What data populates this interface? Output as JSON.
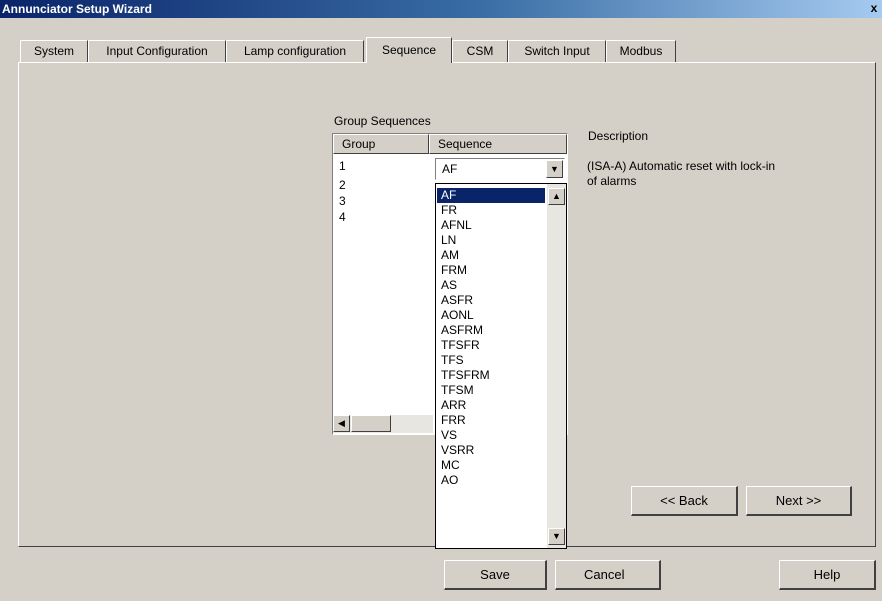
{
  "window": {
    "title": "Annunciator Setup Wizard",
    "close": "x"
  },
  "tabs": [
    "System",
    "Input Configuration",
    "Lamp configuration",
    "Sequence",
    "CSM",
    "Switch Input",
    "Modbus"
  ],
  "group_sequences": {
    "label": "Group Sequences",
    "columns": [
      "Group",
      "Sequence"
    ],
    "groups": [
      "1",
      "2",
      "3",
      "4"
    ],
    "selected_sequence": "AF"
  },
  "dropdown": {
    "options": [
      "AF",
      "FR",
      "AFNL",
      "LN",
      "AM",
      "FRM",
      "AS",
      "ASFR",
      "AONL",
      "ASFRM",
      "TFSFR",
      "TFS",
      "TFSFRM",
      "TFSM",
      "ARR",
      "FRR",
      "VS",
      "VSRR",
      "MC",
      "AO"
    ],
    "selected_index": 0
  },
  "description": {
    "label": "Description",
    "text_line1": "(ISA-A) Automatic reset with lock-in",
    "text_line2": "of alarms"
  },
  "nav": {
    "back": "<< Back",
    "next": "Next >>"
  },
  "footer": {
    "save": "Save",
    "cancel": "Cancel",
    "help": "Help"
  },
  "icons": {
    "scroll_up": "up-arrow",
    "scroll_down": "down-arrow",
    "scroll_left": "left-arrow",
    "combo": "down-arrow"
  }
}
